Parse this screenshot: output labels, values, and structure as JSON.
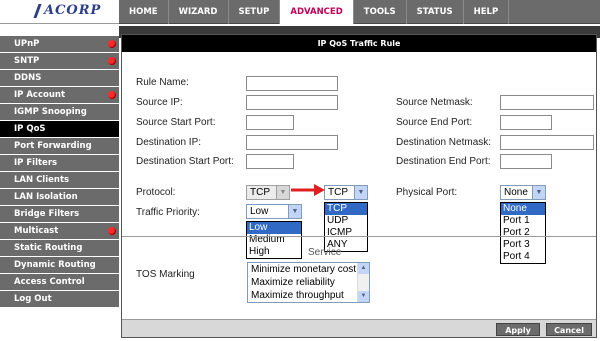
{
  "brand": {
    "logo_text": "ACORP"
  },
  "topnav": {
    "items": [
      {
        "label": "HOME",
        "active": false
      },
      {
        "label": "WIZARD",
        "active": false
      },
      {
        "label": "SETUP",
        "active": false
      },
      {
        "label": "ADVANCED",
        "active": true
      },
      {
        "label": "TOOLS",
        "active": false
      },
      {
        "label": "STATUS",
        "active": false
      },
      {
        "label": "HELP",
        "active": false
      }
    ]
  },
  "sidebar": {
    "items": [
      {
        "label": "UPnP",
        "dot": true
      },
      {
        "label": "SNTP",
        "dot": true
      },
      {
        "label": "DDNS",
        "dot": false
      },
      {
        "label": "IP Account",
        "dot": true
      },
      {
        "label": "IGMP Snooping",
        "dot": false
      },
      {
        "label": "IP QoS",
        "dot": false,
        "active": true
      },
      {
        "label": "Port Forwarding",
        "dot": false
      },
      {
        "label": "IP Filters",
        "dot": false
      },
      {
        "label": "LAN Clients",
        "dot": false
      },
      {
        "label": "LAN Isolation",
        "dot": false
      },
      {
        "label": "Bridge Filters",
        "dot": false
      },
      {
        "label": "Multicast",
        "dot": true
      },
      {
        "label": "Static Routing",
        "dot": false
      },
      {
        "label": "Dynamic Routing",
        "dot": false
      },
      {
        "label": "Access Control",
        "dot": false
      },
      {
        "label": "Log Out",
        "dot": false
      }
    ]
  },
  "panel": {
    "title": "IP QoS Traffic Rule",
    "fields": {
      "rule_name": "Rule Name:",
      "source_ip": "Source IP:",
      "source_netmask": "Source Netmask:",
      "source_start_port": "Source Start Port:",
      "source_end_port": "Source End Port:",
      "destination_ip": "Destination IP:",
      "destination_netmask": "Destination Netmask:",
      "destination_start_port": "Destination Start Port:",
      "destination_end_port": "Destination End Port:",
      "protocol": "Protocol:",
      "physical_port": "Physical Port:",
      "traffic_priority": "Traffic Priority:",
      "tos_marking": "TOS Marking"
    },
    "protocol": {
      "value": "TCP",
      "expanded_value": "TCP",
      "options": [
        "TCP",
        "UDP",
        "ICMP",
        "ANY"
      ]
    },
    "physical_port": {
      "value": "None",
      "options": [
        "None",
        "Port 1",
        "Port 2",
        "Port 3",
        "Port 4"
      ]
    },
    "traffic_priority": {
      "value": "Low",
      "options": [
        "Low",
        "Medium",
        "High"
      ]
    },
    "tos": {
      "partial_label": "Service",
      "options": [
        "Minimize monetary cost",
        "Maximize reliability",
        "Maximize throughput"
      ]
    },
    "buttons": {
      "apply": "Apply",
      "cancel": "Cancel"
    }
  },
  "colors": {
    "nav_bg": "#6b6b6b",
    "active_tab_text": "#c4005a",
    "sidebar_active": "#000000",
    "dot": "#ff2a2a",
    "selection": "#316ac5",
    "annotation_arrow": "#e02020"
  }
}
